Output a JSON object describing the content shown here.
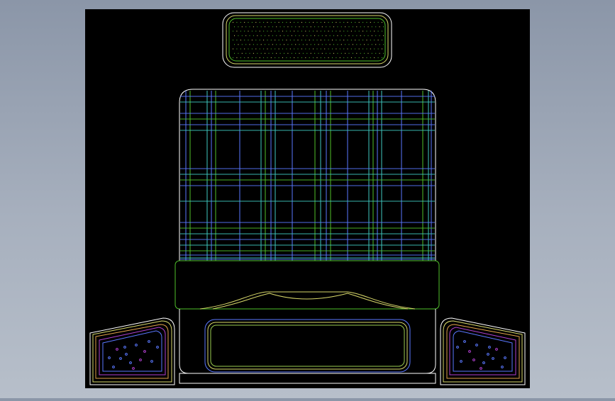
{
  "drawing": {
    "background": "#000000",
    "colors": {
      "white": "#ffffff",
      "yellow": "#d8d86a",
      "green": "#4fc12a",
      "cyan": "#3fc7c0",
      "blue": "#5a78ff",
      "magenta": "#b040d0",
      "orange": "#e0a04a",
      "lightgreen": "#9acd50"
    },
    "headrest": {
      "dot_rows": 9,
      "dot_cols": 40
    },
    "backrest_grid": {
      "vertical_lines": 24,
      "horizontal_lines": 20
    },
    "bolster": {
      "label": ""
    },
    "side_panels": {
      "left_speckles": 14,
      "right_speckles": 14
    }
  }
}
